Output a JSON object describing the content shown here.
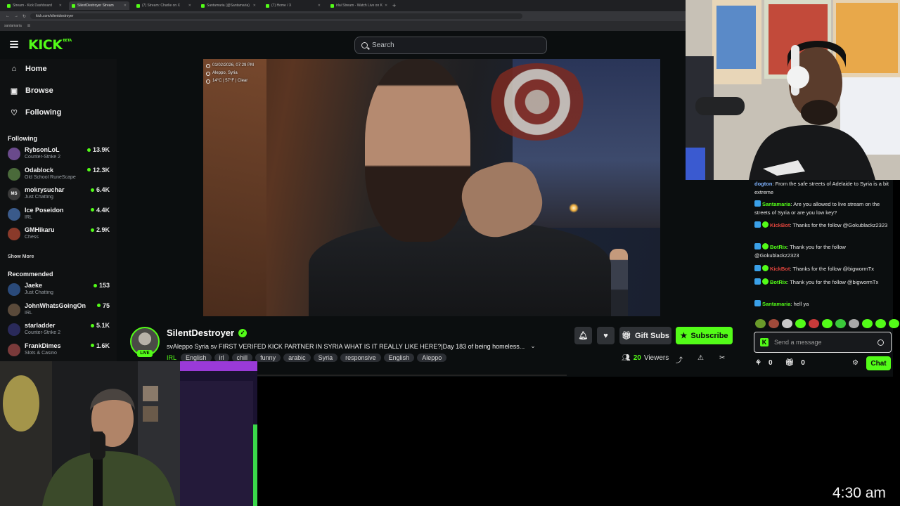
{
  "browser": {
    "tabs": [
      {
        "label": "Stream - Kick Dashboard",
        "active": false
      },
      {
        "label": "SilentDestroyer Stream",
        "active": true
      },
      {
        "label": "(7) Stream: Charlie on X",
        "active": false
      },
      {
        "label": "Santamaria (@Santamaria)",
        "active": false
      },
      {
        "label": "(7) Home / X",
        "active": false
      },
      {
        "label": "irlai Stream - Watch Live on K",
        "active": false
      }
    ],
    "url": "kick.com/silentdestroyer",
    "bookmark": "santamaria"
  },
  "header": {
    "logo": "KICK",
    "logo_sup": "BETA",
    "search_placeholder": "Search"
  },
  "sidebar": {
    "nav": [
      {
        "label": "Home",
        "icon": "home-icon"
      },
      {
        "label": "Browse",
        "icon": "browse-icon"
      },
      {
        "label": "Following",
        "icon": "heart-icon"
      }
    ],
    "following_title": "Following",
    "following": [
      {
        "name": "RybsonLoL",
        "category": "Counter-Strike 2",
        "viewers": "13.9K",
        "color": "#6a4a8c"
      },
      {
        "name": "Odablock",
        "category": "Old School RuneScape",
        "viewers": "12.3K",
        "color": "#4a6a3a"
      },
      {
        "name": "mokrysuchar",
        "category": "Just Chatting",
        "viewers": "6.4K",
        "color": "#3a3a3a",
        "initials": "MS"
      },
      {
        "name": "Ice Poseidon",
        "category": "IRL",
        "viewers": "4.4K",
        "color": "#3a5a8a"
      },
      {
        "name": "GMHikaru",
        "category": "Chess",
        "viewers": "2.9K",
        "color": "#8a3a2a"
      }
    ],
    "show_more": "Show More",
    "recommended_title": "Recommended",
    "recommended": [
      {
        "name": "Jaeke",
        "category": "Just Chatting",
        "viewers": "153",
        "color": "#2a4a7a"
      },
      {
        "name": "JohnWhatsGoingOn",
        "category": "IRL",
        "viewers": "75",
        "color": "#5a4a3a"
      },
      {
        "name": "starladder",
        "category": "Counter-Strike 2",
        "viewers": "5.1K",
        "color": "#2a2a5a"
      },
      {
        "name": "FrankDimes",
        "category": "Slots & Casino",
        "viewers": "1.6K",
        "color": "#7a3a3a"
      }
    ]
  },
  "video": {
    "overlay_date": "01/02/2026, 07:29 PM",
    "overlay_location": "Aleppo, Syria",
    "overlay_weather": "14°C | 57°F | Clear"
  },
  "channel": {
    "name": "SilentDestroyer",
    "live_label": "LIVE",
    "title": "svAleppo Syria  sv FIRST VERIFED KICK PARTNER IN SYRIA WHAT IS IT REALLY LIKE HERE?|Day 183 of being homeless...",
    "category": "IRL",
    "tags": [
      "English",
      "irl",
      "chill",
      "funny",
      "arabic",
      "Syria",
      "responsive",
      "English",
      "Aleppo"
    ],
    "gift_label": "Gift Subs",
    "subscribe_label": "Subscribe",
    "viewers_count": "20",
    "viewers_label": "Viewers"
  },
  "chat": {
    "messages": [
      {
        "user": "dogton",
        "user_color": "#7fb3ff",
        "text": "From the safe streets of Adelaide to Syria is a bit extreme"
      },
      {
        "user": "Santamaria",
        "user_color": "#53fc18",
        "text": "Are you allowed to live stream on the streets of Syria or are you low key?"
      },
      {
        "user": "KickBot",
        "user_color": "#e0443c",
        "text": "Thanks for the follow @Gokublackz2323"
      },
      {
        "user": "BotRix",
        "user_color": "#53fc18",
        "text": "Thank you for the follow @Gokublackz2323"
      },
      {
        "user": "KickBot",
        "user_color": "#e0443c",
        "text": "Thanks for the follow @bigwormTx"
      },
      {
        "user": "BotRix",
        "user_color": "#53fc18",
        "text": "Thank you for the follow @bigwormTx"
      },
      {
        "user": "Santamaria",
        "user_color": "#53fc18",
        "text": "hell ya"
      }
    ],
    "input_placeholder": "Send a message",
    "points": "0",
    "gifts": "0",
    "send_label": "Chat"
  },
  "clock": "4:30 am",
  "colors": {
    "accent": "#53fc18",
    "bg": "#0b0e0f"
  }
}
